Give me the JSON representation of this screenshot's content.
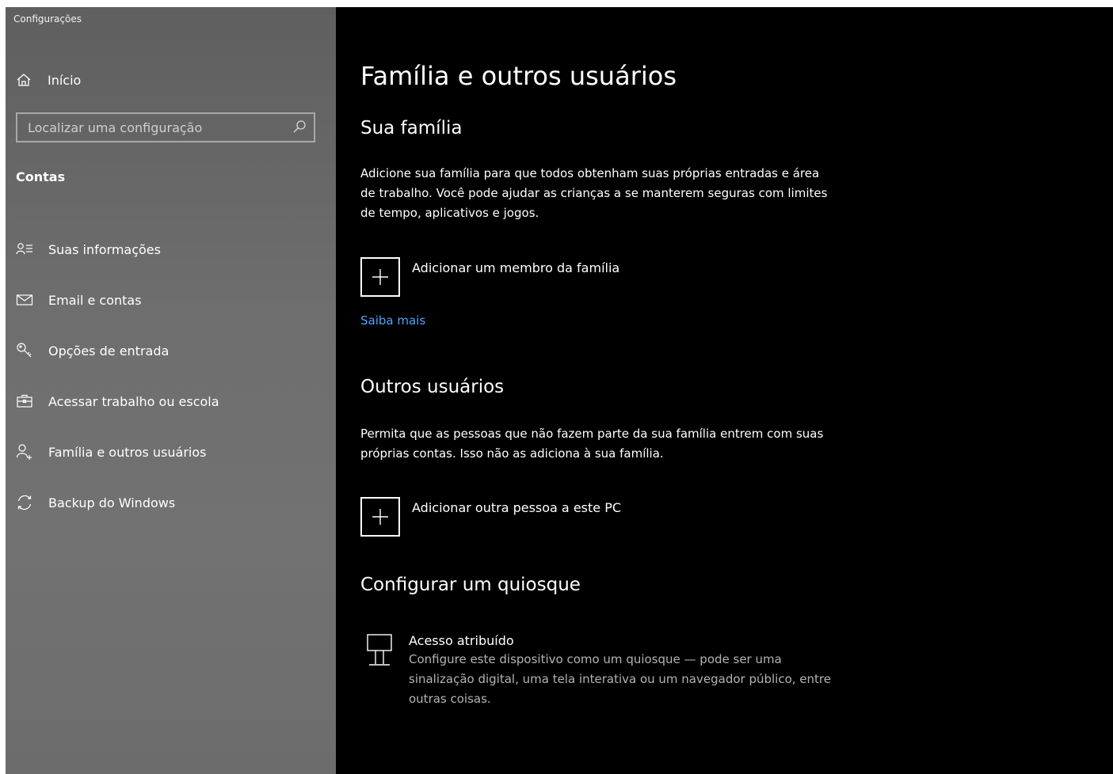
{
  "app": {
    "title": "Configurações"
  },
  "sidebar": {
    "home_label": "Início",
    "search_placeholder": "Localizar uma configuração",
    "section_label": "Contas",
    "items": [
      {
        "label": "Suas informações",
        "icon": "person-info-icon"
      },
      {
        "label": "Email e contas",
        "icon": "mail-icon"
      },
      {
        "label": "Opções de entrada",
        "icon": "key-icon"
      },
      {
        "label": "Acessar trabalho ou escola",
        "icon": "briefcase-icon"
      },
      {
        "label": "Família e outros usuários",
        "icon": "add-person-icon"
      },
      {
        "label": "Backup do Windows",
        "icon": "sync-icon"
      }
    ]
  },
  "main": {
    "title": "Família e outros usuários",
    "family": {
      "heading": "Sua família",
      "description": "Adicione sua família para que todos obtenham suas próprias entradas e área de trabalho. Você pode ajudar as crianças a se manterem seguras com limites de tempo, aplicativos e jogos.",
      "add_label": "Adicionar um membro da família",
      "learn_more": "Saiba mais"
    },
    "others": {
      "heading": "Outros usuários",
      "description": "Permita que as pessoas que não fazem parte da sua família entrem com suas próprias contas. Isso não as adiciona à sua família.",
      "add_label": "Adicionar outra pessoa a este PC"
    },
    "kiosk": {
      "heading": "Configurar um quiosque",
      "title": "Acesso atribuído",
      "description": "Configure este dispositivo como um quiosque — pode ser uma sinalização digital, uma tela interativa ou um navegador público, entre outras coisas."
    }
  },
  "colors": {
    "sidebar_bg": "#6a6a6a",
    "content_bg": "#000000",
    "link": "#4ea3ff",
    "text": "#ffffff",
    "muted_text": "#b3b3b3"
  }
}
